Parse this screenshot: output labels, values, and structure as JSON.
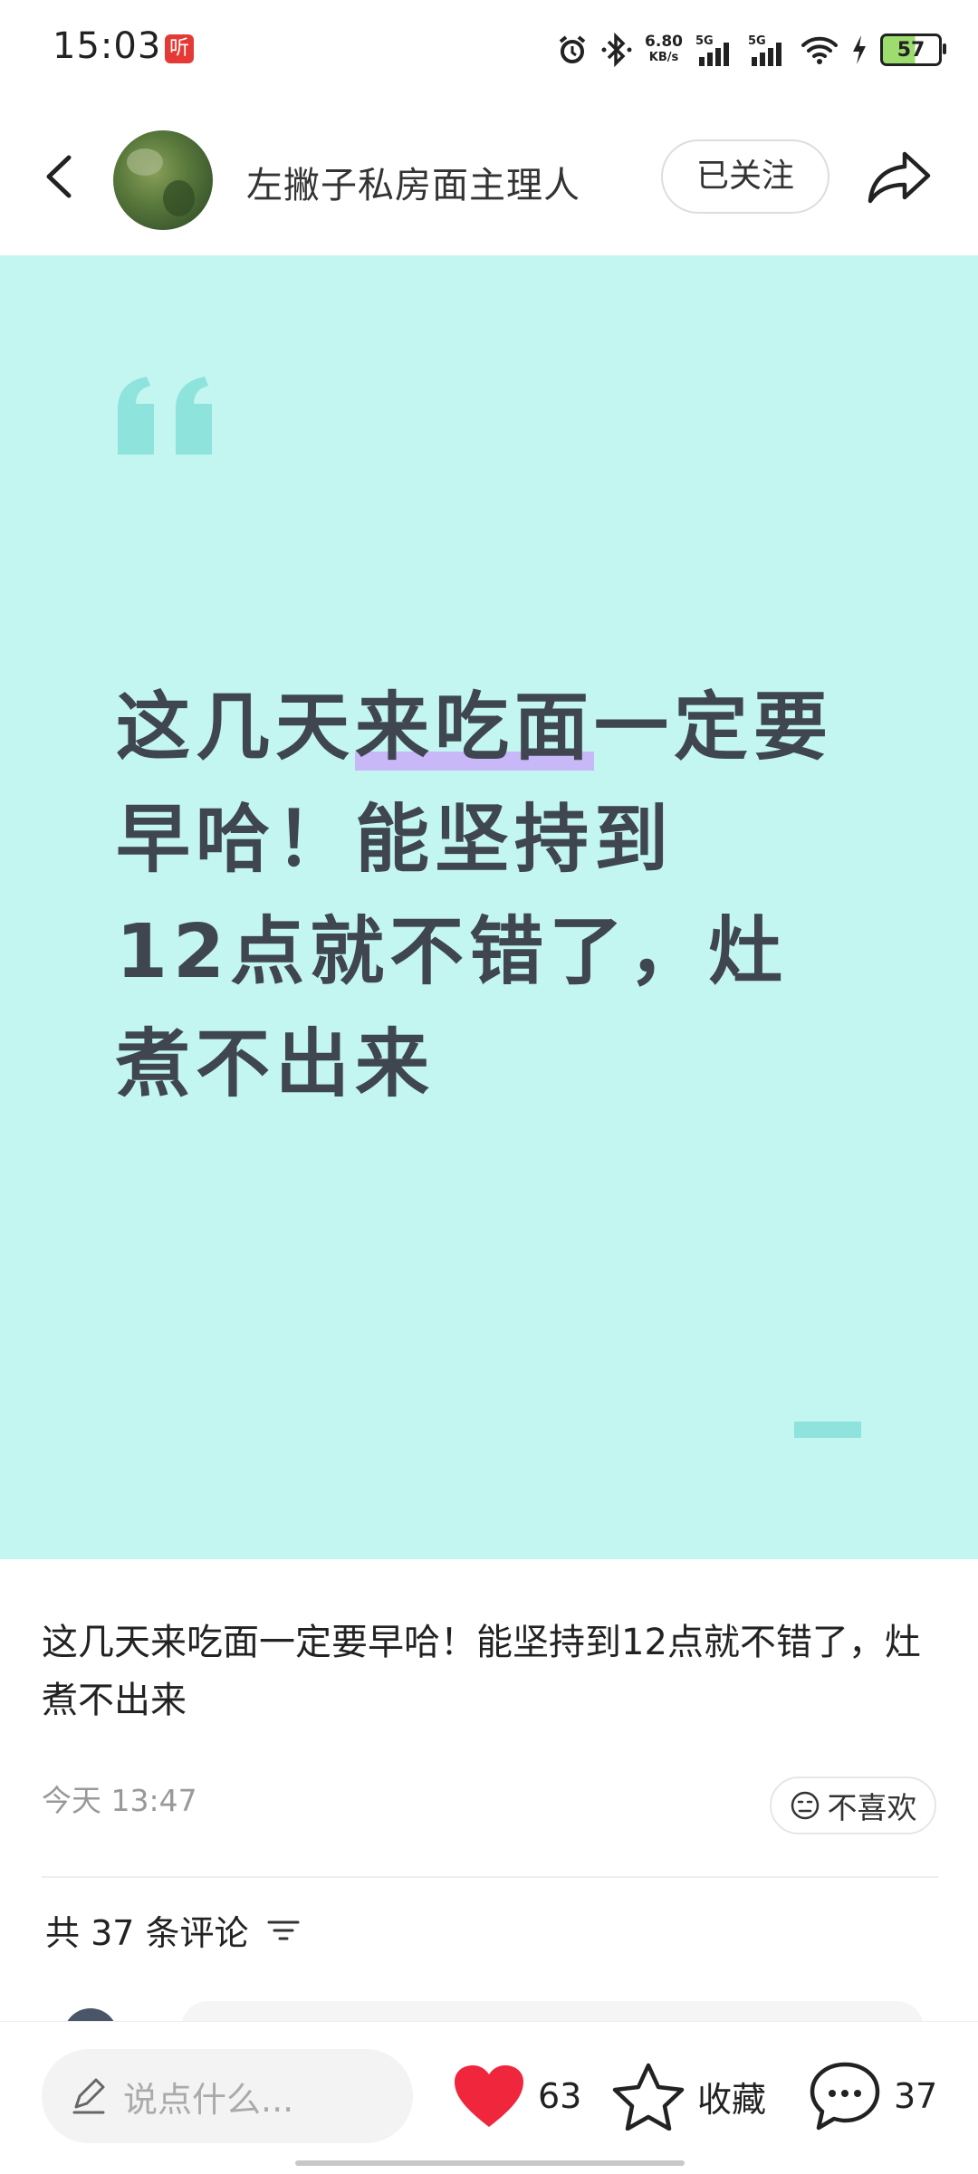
{
  "status_bar": {
    "time": "15:03",
    "app_badge": "听",
    "net_speed_value": "6.80",
    "net_speed_unit": "KB/s",
    "signal1_label": "5G",
    "signal2_label": "5G",
    "battery": "57",
    "icons": [
      "alarm-icon",
      "bluetooth-icon",
      "signal-icon",
      "signal-icon",
      "wifi-icon",
      "charging-icon",
      "battery-icon"
    ]
  },
  "header": {
    "author_name": "左撇子私房面主理人",
    "follow_label": "已关注"
  },
  "card": {
    "text_before": "这几天",
    "text_highlight": "来吃面",
    "text_after_line1": "一定要",
    "line2": "早哈！能坚持到",
    "line3": "12点就不错了，灶",
    "line4": "煮不出来",
    "background_color": "#c3f5f1",
    "quote_color": "#8ee3dc",
    "highlight_color": "#c9b8f7"
  },
  "post": {
    "text": "这几天来吃面一定要早哈！能坚持到12点就不错了，灶煮不出来",
    "time": "今天 13:47",
    "dislike_label": "不喜欢"
  },
  "comments": {
    "count_label": "共 37 条评论"
  },
  "bottom_bar": {
    "input_placeholder": "说点什么...",
    "like_count": "63",
    "collect_label": "收藏",
    "comment_count": "37",
    "like_color": "#f0263c"
  }
}
